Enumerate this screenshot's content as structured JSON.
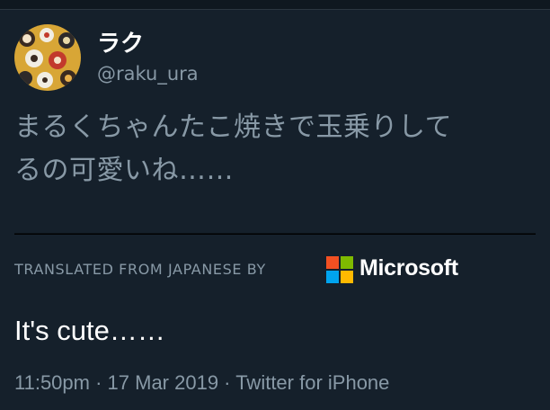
{
  "tweet": {
    "author": {
      "display_name": "ラク",
      "handle": "@raku_ura",
      "avatar_icon": "avatar-image-icon"
    },
    "text_lines": [
      "まるくちゃんたこ焼きで玉乗りして",
      "るの可愛いね……"
    ],
    "translation": {
      "label": "TRANSLATED FROM JAPANESE BY",
      "provider": "Microsoft",
      "provider_icon": "microsoft-logo-icon",
      "text": "It's cute……"
    },
    "meta": "11:50pm · 17 Mar 2019 · Twitter for iPhone"
  },
  "colors": {
    "background": "#15202b",
    "primary_text": "#ffffff",
    "secondary_text": "#8899a6",
    "ms_red": "#f25022",
    "ms_green": "#7fba00",
    "ms_blue": "#00a4ef",
    "ms_yellow": "#ffb900"
  }
}
